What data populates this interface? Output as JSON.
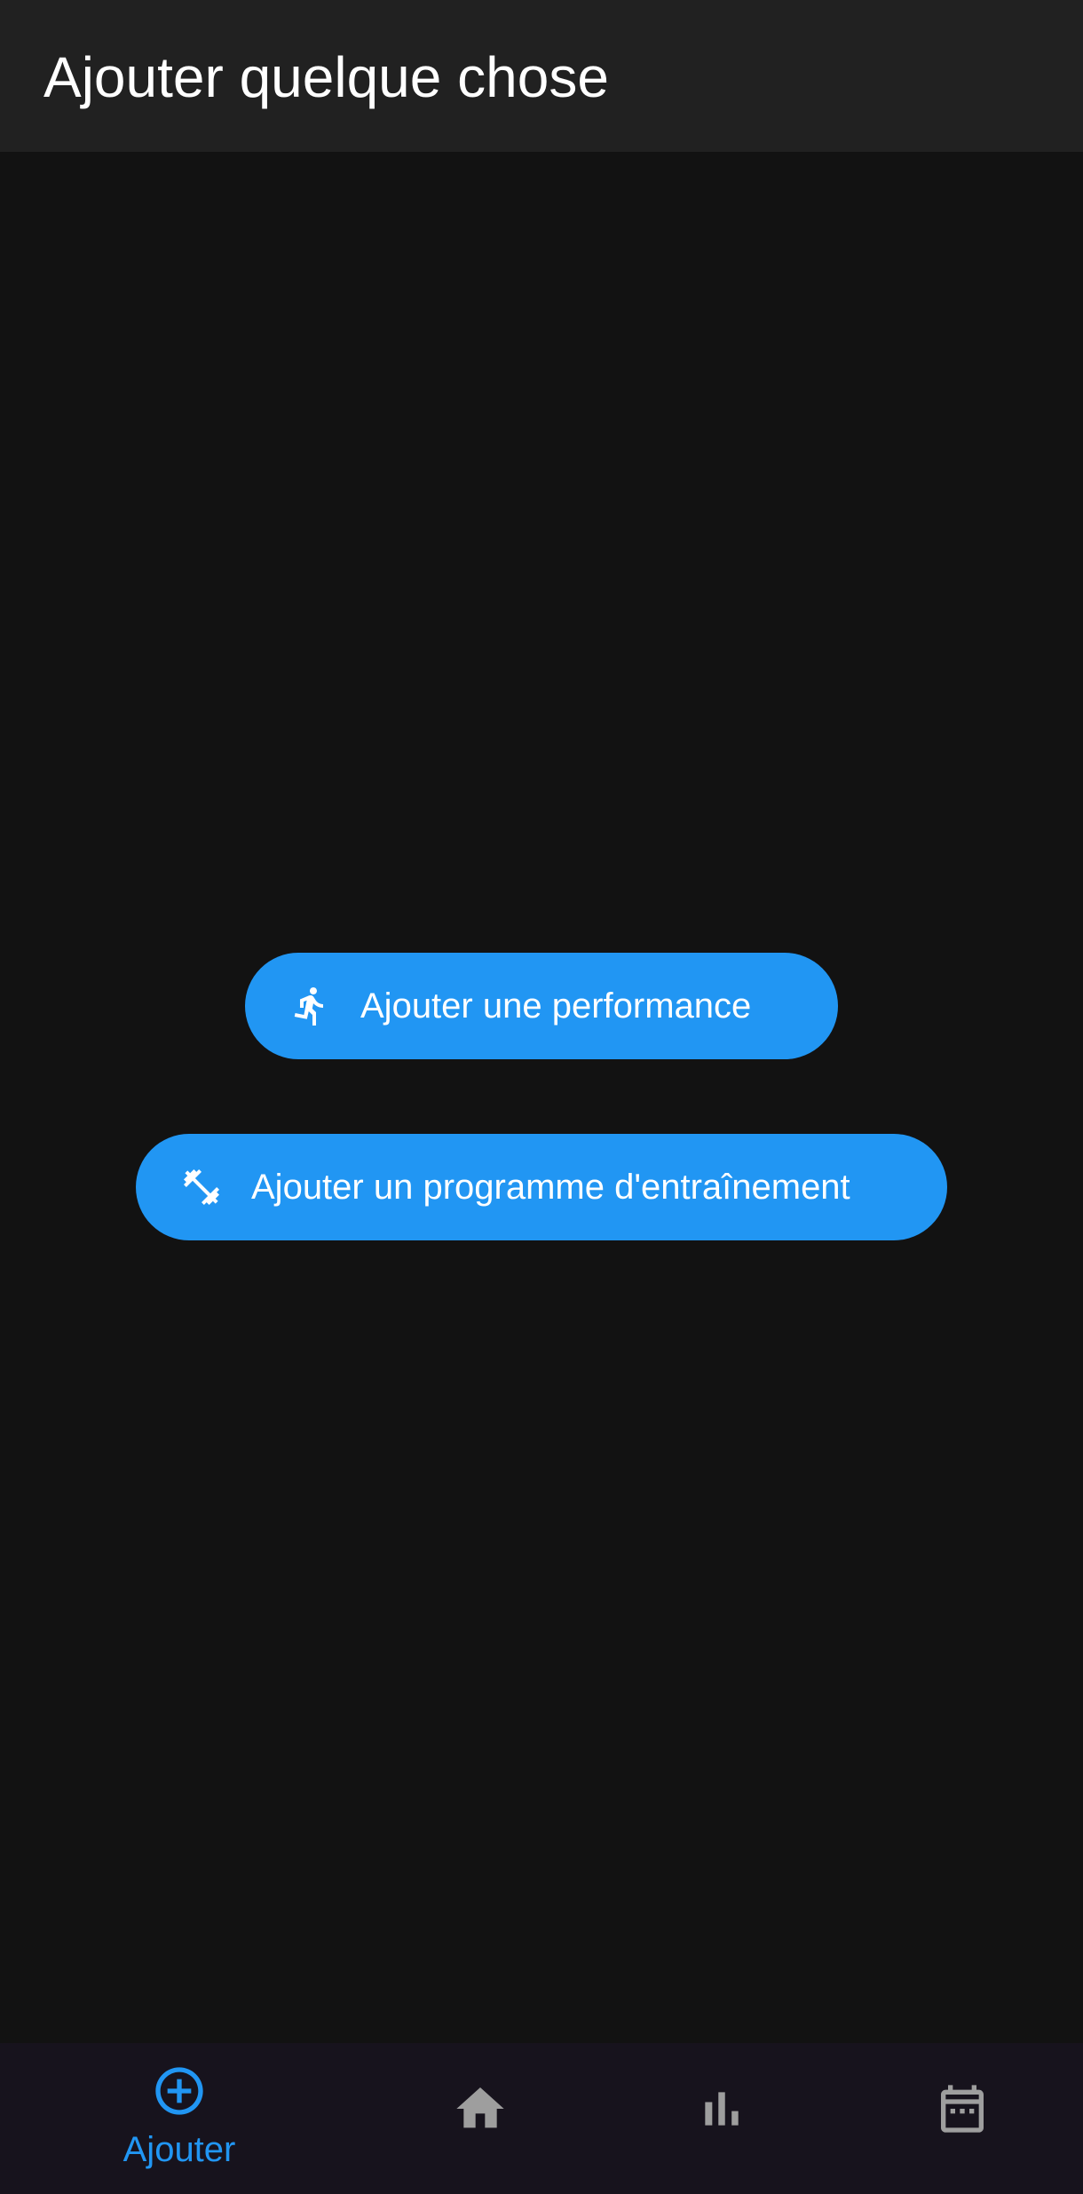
{
  "app_bar": {
    "title": "Ajouter quelque chose"
  },
  "main": {
    "buttons": [
      {
        "label": "Ajouter une performance",
        "icon": "running-icon"
      },
      {
        "label": "Ajouter un programme d'entraînement",
        "icon": "dumbbell-icon"
      }
    ]
  },
  "bottom_nav": {
    "items": [
      {
        "label": "Ajouter",
        "icon": "add-circle-icon",
        "selected": true
      },
      {
        "label": "",
        "icon": "home-icon",
        "selected": false
      },
      {
        "label": "",
        "icon": "bar-chart-icon",
        "selected": false
      },
      {
        "label": "",
        "icon": "calendar-icon",
        "selected": false
      }
    ]
  },
  "colors": {
    "accent": "#2196F3",
    "app_bar_bg": "#212121",
    "background": "#121212",
    "bottom_nav_bg": "#17131D",
    "inactive_icon": "#9E9E9E"
  }
}
